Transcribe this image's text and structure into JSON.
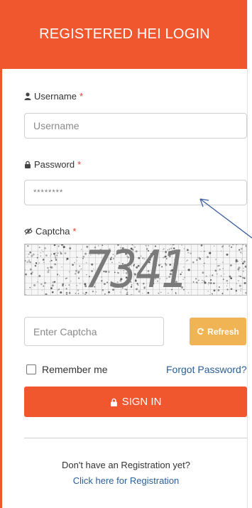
{
  "header": {
    "title": "REGISTERED HEI LOGIN"
  },
  "username": {
    "label": "Username",
    "required": "*",
    "placeholder": "Username"
  },
  "password": {
    "label": "Password",
    "required": "*",
    "value": "********"
  },
  "captcha": {
    "label": "Captcha",
    "required": "*",
    "code": "7341",
    "placeholder": "Enter Captcha"
  },
  "refresh": {
    "label": "Refresh"
  },
  "remember": {
    "label": "Remember me"
  },
  "forgot": {
    "label": "Forgot Password?"
  },
  "signin": {
    "label": "SIGN IN"
  },
  "footer": {
    "prompt": "Don't have an Registration yet?",
    "link": "Click here for Registration"
  },
  "colors": {
    "brand": "#f1572e",
    "refresh": "#f0b455",
    "link": "#2b5e9a",
    "required": "#e53935"
  },
  "icons": [
    "user-icon",
    "lock-icon",
    "eye-slash-icon",
    "refresh-icon"
  ]
}
